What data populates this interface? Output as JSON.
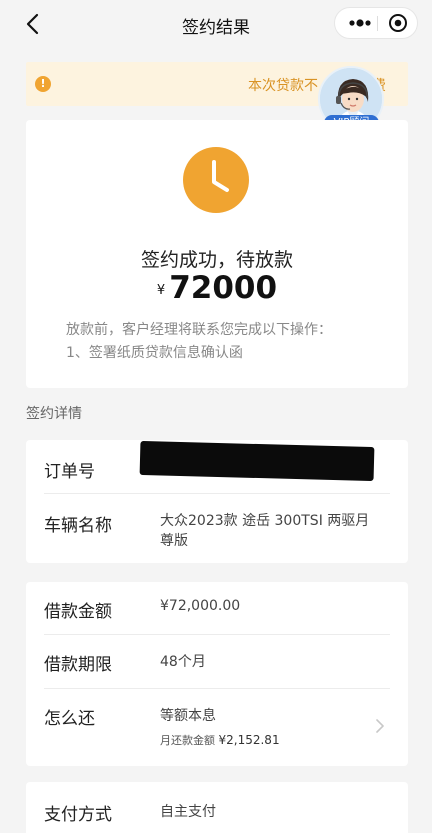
{
  "nav": {
    "title": "签约结果",
    "back_icon": "chevron-left-icon",
    "more_icon": "more-dots-icon",
    "close_icon": "target-circle-icon"
  },
  "notice": {
    "text": "本次贷款不",
    "text_tail": "费",
    "icon": "exclamation-icon",
    "color": "#d99325"
  },
  "vip": {
    "badge": "VIP顾问",
    "icon": "advisor-avatar"
  },
  "result": {
    "status": "签约成功，待放款",
    "currency": "¥",
    "amount": "72000",
    "tip_line1": "放款前，客户经理将联系您完成以下操作：",
    "tip_line2": "1、签署纸质贷款信息确认函",
    "clock_color": "#f0a431"
  },
  "section": {
    "label": "签约详情"
  },
  "details1": {
    "order_label": "订单号",
    "order_value": "",
    "vehicle_label": "车辆名称",
    "vehicle_value": "大众2023款 途岳 300TSI 两驱月尊版"
  },
  "details2": {
    "amount_label": "借款金额",
    "amount_value": "¥72,000.00",
    "term_label": "借款期限",
    "term_value": "48个月",
    "repay_label": "怎么还",
    "repay_value": "等额本息",
    "monthly_label": "月还款金额",
    "monthly_value": "¥2,152.81"
  },
  "details3": {
    "pay_label": "支付方式",
    "pay_value": "自主支付"
  }
}
